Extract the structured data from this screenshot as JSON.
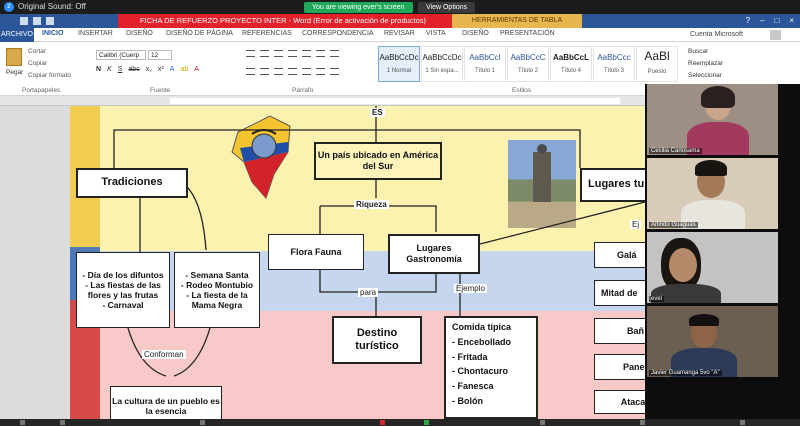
{
  "zoom": {
    "window_title": "Original Sound: Off",
    "viewing_banner": "You are viewing ever's screen",
    "view_options": "View Options"
  },
  "word": {
    "title": "FICHA DE REFUERZO PROYECTO INTER - Word (Error de activación de productos)",
    "contextual_tab": "HERRAMIENTAS DE TABLA",
    "tabs": [
      "ARCHIVO",
      "INICIO",
      "INSERTAR",
      "DISEÑO",
      "DISEÑO DE PÁGINA",
      "REFERENCIAS",
      "CORRESPONDENCIA",
      "REVISAR",
      "VISTA",
      "DISEÑO",
      "PRESENTACIÓN"
    ],
    "account": "Cuenta Microsoft",
    "clipboard": {
      "paste": "Pegar",
      "cut": "Cortar",
      "copy": "Copiar",
      "format_painter": "Copiar formato",
      "group": "Portapapeles"
    },
    "font": {
      "name": "Calibri (Cuerp",
      "size": "12",
      "group": "Fuente"
    },
    "paragraph_group": "Párrafo",
    "styles": [
      {
        "sample": "AaBbCcDc",
        "name": "1 Normal"
      },
      {
        "sample": "AaBbCcDc",
        "name": "1 Sin espa..."
      },
      {
        "sample": "AaBbCcI",
        "name": "Título 1"
      },
      {
        "sample": "AaBbCcC",
        "name": "Título 2"
      },
      {
        "sample": "AaBbCcL",
        "name": "Título 4"
      },
      {
        "sample": "AaBbCcc",
        "name": "Título 3"
      },
      {
        "sample": "AaBl",
        "name": "Puesto"
      }
    ],
    "styles_group": "Estilos",
    "editing": {
      "find": "Buscar",
      "replace": "Reemplazar",
      "select": "Seleccionar"
    }
  },
  "diagram": {
    "es": "ES",
    "root": "Un país ubicado en América del Sur",
    "riqueza": "Riqueza",
    "tradiciones": "Tradiciones",
    "tradiciones_list_1": [
      "- Día de los difuntos",
      "- Las fiestas de las flores y las frutas",
      "- Carnaval"
    ],
    "tradiciones_list_2": [
      "- Semana Santa",
      "- Rodeo Montubio",
      "- La fiesta de la Mama Negra"
    ],
    "conforman": "Conforman",
    "cultura": "La cultura de un pueblo es la esencia",
    "flora": "Flora Fauna",
    "lugares": "Lugares Gastronomía",
    "para": "para",
    "ejemplo": "Ejemplo",
    "destino": "Destino turístico",
    "comida_title": "Comida típica",
    "comida": [
      "- Encebollado",
      "- Fritada",
      "- Chontacuro",
      "- Fanesca",
      "- Bolón"
    ],
    "lugares_tur": "Lugares tu",
    "ej": "Ej",
    "places": [
      "Galá",
      "Mitad de",
      "Bañ",
      "Pane",
      "Atacames"
    ]
  },
  "participants": [
    {
      "name": "Cecilia Carlosama"
    },
    {
      "name": "Arlindo Guaguas"
    },
    {
      "name": "evel"
    },
    {
      "name": "Javier Guamanga 5vo \"A\""
    }
  ]
}
